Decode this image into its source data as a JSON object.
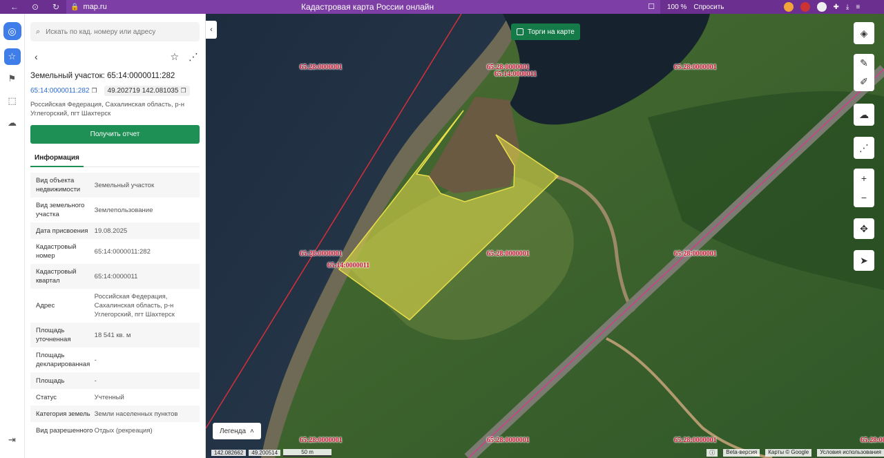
{
  "browser": {
    "url": "map.ru",
    "title": "Кадастровая карта России онлайн",
    "zoom": "100 %",
    "ask": "Спросить"
  },
  "search": {
    "placeholder": "Искать по кад. номеру или адресу"
  },
  "parcel": {
    "title": "Земельный участок: 65:14:0000011:282",
    "cad_number": "65:14:0000011:282",
    "coords": "49.202719 142.081035",
    "address": "Российская Федерация, Сахалинская область, р-н Углегорский, пгт Шахтерск",
    "report_button": "Получить отчет",
    "tab_info": "Информация"
  },
  "info_rows": [
    {
      "k": "Вид объекта недвижимости",
      "v": "Земельный участок"
    },
    {
      "k": "Вид земельного участка",
      "v": "Землепользование"
    },
    {
      "k": "Дата присвоения",
      "v": "19.08.2025"
    },
    {
      "k": "Кадастровый номер",
      "v": "65:14:0000011:282"
    },
    {
      "k": "Кадастровый квартал",
      "v": "65:14:0000011"
    },
    {
      "k": "Адрес",
      "v": "Российская Федерация, Сахалинская область, р-н Углегорский, пгт Шахтерск"
    },
    {
      "k": "Площадь уточненная",
      "v": "18 541 кв. м"
    },
    {
      "k": "Площадь декларированная",
      "v": "-"
    },
    {
      "k": "Площадь",
      "v": "-"
    },
    {
      "k": "Статус",
      "v": "Учтенный"
    },
    {
      "k": "Категория земель",
      "v": "Земли населенных пунктов"
    },
    {
      "k": "Вид разрешенного",
      "v": "Отдых (рекреация)"
    }
  ],
  "map": {
    "tender_label": "Торги на карте",
    "legend_label": "Легенда",
    "coord_lon": "142.082662",
    "coord_lat": "49.200514",
    "scale": "50 m",
    "beta": "Beta-версия",
    "attribution": "Карты © Google",
    "terms": "Условия использования",
    "labels": [
      {
        "id": "l1",
        "text": "65:28:0000001"
      },
      {
        "id": "l2",
        "text": "65:28:0000001"
      },
      {
        "id": "l3",
        "text": "65:14:0000011"
      },
      {
        "id": "l4",
        "text": "65:28:0000001"
      },
      {
        "id": "l5",
        "text": "65:28:0000001"
      },
      {
        "id": "l6",
        "text": "65:14:0000011"
      },
      {
        "id": "l7",
        "text": "65:28:0000001"
      },
      {
        "id": "l8",
        "text": "65:28:0000001"
      },
      {
        "id": "l9",
        "text": "65:28:0000001"
      },
      {
        "id": "l10",
        "text": "65:28:0000001"
      },
      {
        "id": "l11",
        "text": "65:28:0000001"
      },
      {
        "id": "l12",
        "text": "65:28:0000001"
      }
    ]
  },
  "colors": {
    "accent": "#1e9055",
    "brand": "#3f7de8",
    "cadastral_label": "#c6112a",
    "parcel_fill": "#e9df4a"
  }
}
